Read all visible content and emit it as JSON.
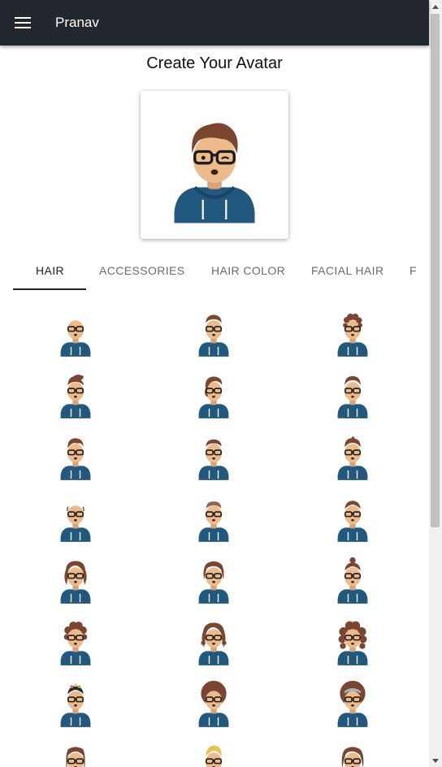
{
  "appbar": {
    "title": "Pranav",
    "menu_icon": "hamburger-menu-icon",
    "bg": "#23272e"
  },
  "page": {
    "title": "Create Your Avatar"
  },
  "preview": {
    "alt": "avatar preview",
    "skin": "#ecba8b",
    "hair": "#7a4632",
    "hoodie": "#22577e"
  },
  "tabs": [
    {
      "label": "HAIR",
      "active": true
    },
    {
      "label": "ACCESSORIES",
      "active": false
    },
    {
      "label": "HAIR COLOR",
      "active": false
    },
    {
      "label": "FACIAL HAIR",
      "active": false
    },
    {
      "label": "F",
      "active": false
    }
  ],
  "hair_options": [
    {
      "style": "bald"
    },
    {
      "style": "short-flat"
    },
    {
      "style": "curly-short"
    },
    {
      "style": "quiff"
    },
    {
      "style": "side-shave"
    },
    {
      "style": "short-round"
    },
    {
      "style": "short-wavy"
    },
    {
      "style": "caesar"
    },
    {
      "style": "frizzle"
    },
    {
      "style": "bald-sides"
    },
    {
      "style": "buzz"
    },
    {
      "style": "short-sides"
    },
    {
      "style": "long-wavy"
    },
    {
      "style": "bob"
    },
    {
      "style": "top-bun"
    },
    {
      "style": "curly-medium"
    },
    {
      "style": "long-curly"
    },
    {
      "style": "big-curly"
    },
    {
      "style": "flower-crown"
    },
    {
      "style": "afro"
    },
    {
      "style": "afro-headband"
    },
    {
      "style": "straight-long"
    },
    {
      "style": "blonde-short"
    },
    {
      "style": "bob-long"
    }
  ],
  "colors": {
    "skin": "#ecba8b",
    "hair": "#7a4632",
    "blonde": "#e4c35a",
    "hoodie": "#22577e",
    "glasses": "#1b1b1b",
    "accent": "#222222"
  }
}
